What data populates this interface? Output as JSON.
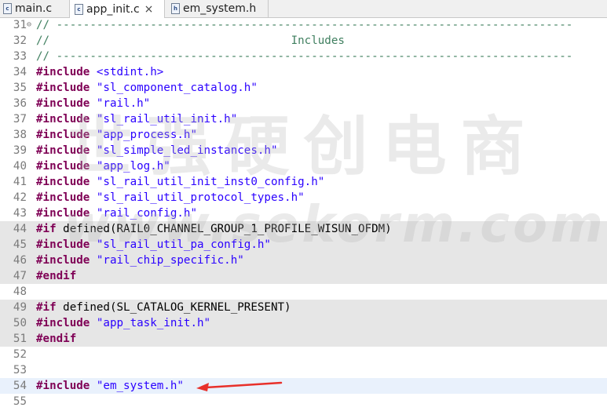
{
  "tabs": [
    {
      "label": "main.c",
      "icon": "c-file-icon",
      "active": false
    },
    {
      "label": "app_init.c",
      "icon": "c-file-icon",
      "active": true,
      "close": "×"
    },
    {
      "label": "em_system.h",
      "icon": "h-file-icon",
      "active": false
    }
  ],
  "file_icon_letters": {
    "c": "c",
    "h": "h"
  },
  "colors": {
    "keyword": "#7f0055",
    "string": "#2a00ff",
    "comment": "#3f7f5f",
    "arrow": "#e8302a"
  },
  "lines": [
    {
      "num": "31",
      "fold": "⊖",
      "parts": [
        {
          "t": "comment",
          "v": "// -----------------------------------------------------------------------------"
        }
      ]
    },
    {
      "num": "32",
      "parts": [
        {
          "t": "comment",
          "v": "//                                    Includes"
        }
      ]
    },
    {
      "num": "33",
      "parts": [
        {
          "t": "comment",
          "v": "// -----------------------------------------------------------------------------"
        }
      ]
    },
    {
      "num": "34",
      "parts": [
        {
          "t": "kw",
          "v": "#include"
        },
        {
          "t": "plain",
          "v": " "
        },
        {
          "t": "str",
          "v": "<stdint.h>"
        }
      ]
    },
    {
      "num": "35",
      "parts": [
        {
          "t": "kw",
          "v": "#include"
        },
        {
          "t": "plain",
          "v": " "
        },
        {
          "t": "str",
          "v": "\"sl_component_catalog.h\""
        }
      ]
    },
    {
      "num": "36",
      "parts": [
        {
          "t": "kw",
          "v": "#include"
        },
        {
          "t": "plain",
          "v": " "
        },
        {
          "t": "str",
          "v": "\"rail.h\""
        }
      ]
    },
    {
      "num": "37",
      "parts": [
        {
          "t": "kw",
          "v": "#include"
        },
        {
          "t": "plain",
          "v": " "
        },
        {
          "t": "str",
          "v": "\"sl_rail_util_init.h\""
        }
      ]
    },
    {
      "num": "38",
      "parts": [
        {
          "t": "kw",
          "v": "#include"
        },
        {
          "t": "plain",
          "v": " "
        },
        {
          "t": "str",
          "v": "\"app_process.h\""
        }
      ]
    },
    {
      "num": "39",
      "parts": [
        {
          "t": "kw",
          "v": "#include"
        },
        {
          "t": "plain",
          "v": " "
        },
        {
          "t": "str",
          "v": "\"sl_simple_led_instances.h\""
        }
      ]
    },
    {
      "num": "40",
      "parts": [
        {
          "t": "kw",
          "v": "#include"
        },
        {
          "t": "plain",
          "v": " "
        },
        {
          "t": "str",
          "v": "\"app_log.h\""
        }
      ]
    },
    {
      "num": "41",
      "parts": [
        {
          "t": "kw",
          "v": "#include"
        },
        {
          "t": "plain",
          "v": " "
        },
        {
          "t": "str",
          "v": "\"sl_rail_util_init_inst0_config.h\""
        }
      ]
    },
    {
      "num": "42",
      "parts": [
        {
          "t": "kw",
          "v": "#include"
        },
        {
          "t": "plain",
          "v": " "
        },
        {
          "t": "str",
          "v": "\"sl_rail_util_protocol_types.h\""
        }
      ]
    },
    {
      "num": "43",
      "parts": [
        {
          "t": "kw",
          "v": "#include"
        },
        {
          "t": "plain",
          "v": " "
        },
        {
          "t": "str",
          "v": "\"rail_config.h\""
        }
      ]
    },
    {
      "num": "44",
      "hl": "gray",
      "parts": [
        {
          "t": "kw",
          "v": "#if"
        },
        {
          "t": "plain",
          "v": " defined(RAIL0_CHANNEL_GROUP_1_PROFILE_WISUN_OFDM)"
        }
      ]
    },
    {
      "num": "45",
      "hl": "gray",
      "parts": [
        {
          "t": "kw",
          "v": "#include"
        },
        {
          "t": "plain",
          "v": " "
        },
        {
          "t": "str",
          "v": "\"sl_rail_util_pa_config.h\""
        }
      ]
    },
    {
      "num": "46",
      "hl": "gray",
      "parts": [
        {
          "t": "kw",
          "v": "#include"
        },
        {
          "t": "plain",
          "v": " "
        },
        {
          "t": "str",
          "v": "\"rail_chip_specific.h\""
        }
      ]
    },
    {
      "num": "47",
      "hl": "gray",
      "parts": [
        {
          "t": "kw",
          "v": "#endif"
        }
      ]
    },
    {
      "num": "48",
      "parts": []
    },
    {
      "num": "49",
      "hl": "gray",
      "parts": [
        {
          "t": "kw",
          "v": "#if"
        },
        {
          "t": "plain",
          "v": " defined(SL_CATALOG_KERNEL_PRESENT)"
        }
      ]
    },
    {
      "num": "50",
      "hl": "gray",
      "parts": [
        {
          "t": "kw",
          "v": "#include"
        },
        {
          "t": "plain",
          "v": " "
        },
        {
          "t": "str",
          "v": "\"app_task_init.h\""
        }
      ]
    },
    {
      "num": "51",
      "hl": "gray",
      "parts": [
        {
          "t": "kw",
          "v": "#endif"
        }
      ]
    },
    {
      "num": "52",
      "parts": []
    },
    {
      "num": "53",
      "parts": []
    },
    {
      "num": "54",
      "hl": "blue",
      "parts": [
        {
          "t": "kw",
          "v": "#include"
        },
        {
          "t": "plain",
          "v": " "
        },
        {
          "t": "str",
          "v": "\"em_system.h\""
        }
      ]
    },
    {
      "num": "55",
      "parts": []
    }
  ],
  "watermark": {
    "cn": "世强硬创电商",
    "en": "www.sekorm.com"
  }
}
